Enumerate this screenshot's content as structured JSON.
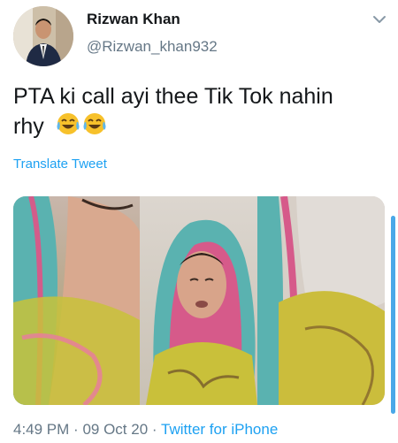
{
  "user": {
    "name": "Rizwan Khan",
    "handle": "@Rizwan_khan932",
    "avatar_icon": "profile-photo"
  },
  "menu": {
    "icon": "chevron-down-icon"
  },
  "tweet": {
    "text_line1": "PTA ki call ayi thee Tik Tok nahin",
    "text_line2": "rhy",
    "emojis": [
      "face-with-tears-of-joy",
      "face-with-tears-of-joy"
    ]
  },
  "translate_label": "Translate Tweet",
  "media": {
    "kind": "video-frames-collage",
    "frames": 3
  },
  "meta": {
    "time": "4:49 PM",
    "sep1": "·",
    "date": "09 Oct 20",
    "sep2": "·",
    "source": "Twitter for iPhone"
  },
  "colors": {
    "link": "#1da1f2",
    "secondary": "#657786",
    "text": "#14171a"
  }
}
